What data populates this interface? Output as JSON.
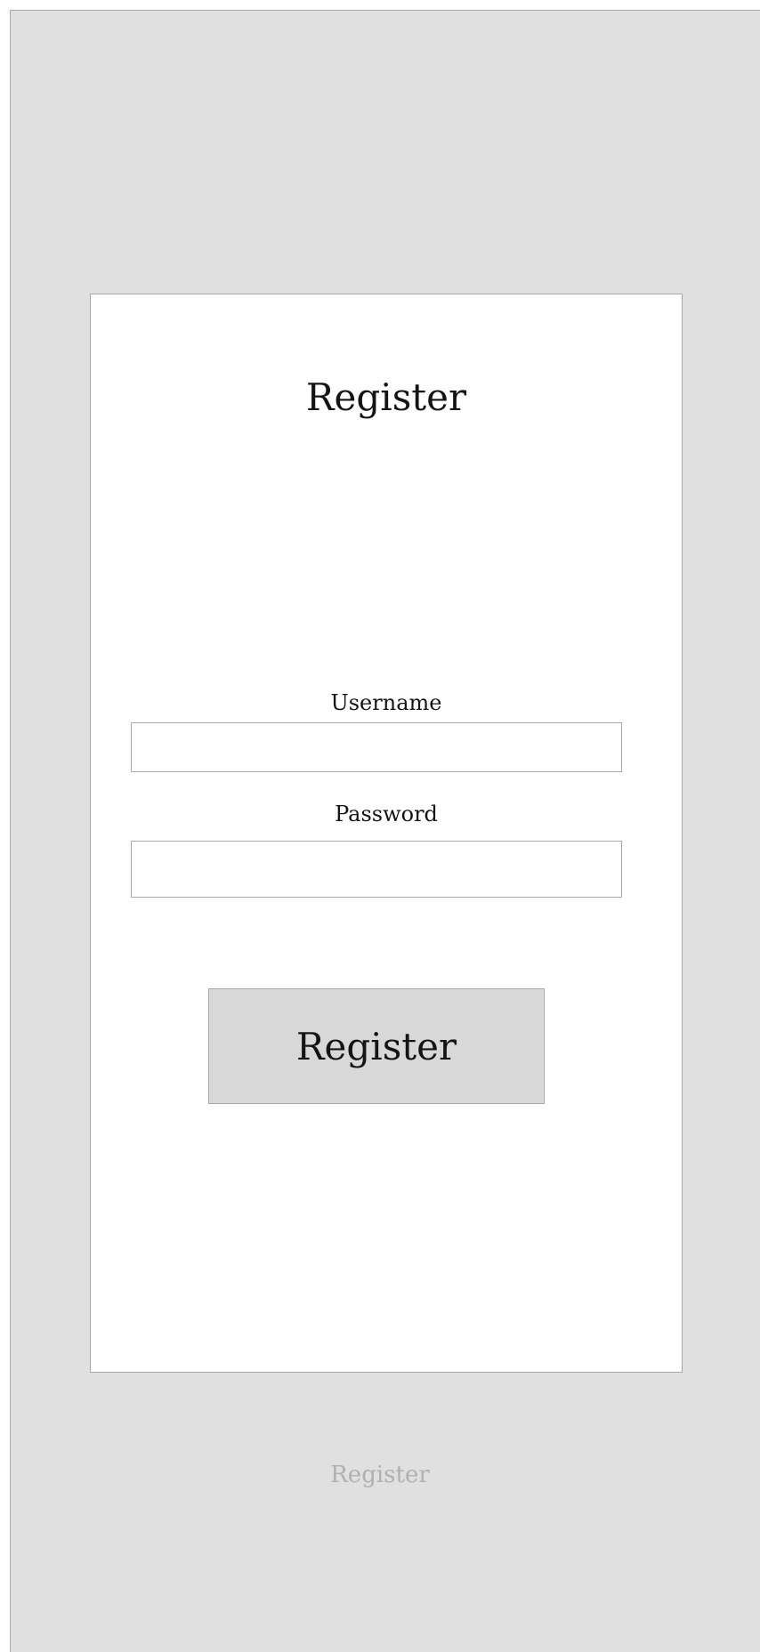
{
  "colors": {
    "background": "#e0e0e0",
    "card": "#ffffff",
    "border": "#a8a8a8",
    "button": "#d8d8d8",
    "text": "#141414",
    "muted_text": "#b0b0b0"
  },
  "form": {
    "title": "Register",
    "username": {
      "label": "Username",
      "value": "",
      "placeholder": ""
    },
    "password": {
      "label": "Password",
      "value": "",
      "placeholder": ""
    },
    "submit_label": "Register"
  },
  "footer": {
    "label": "Register"
  }
}
